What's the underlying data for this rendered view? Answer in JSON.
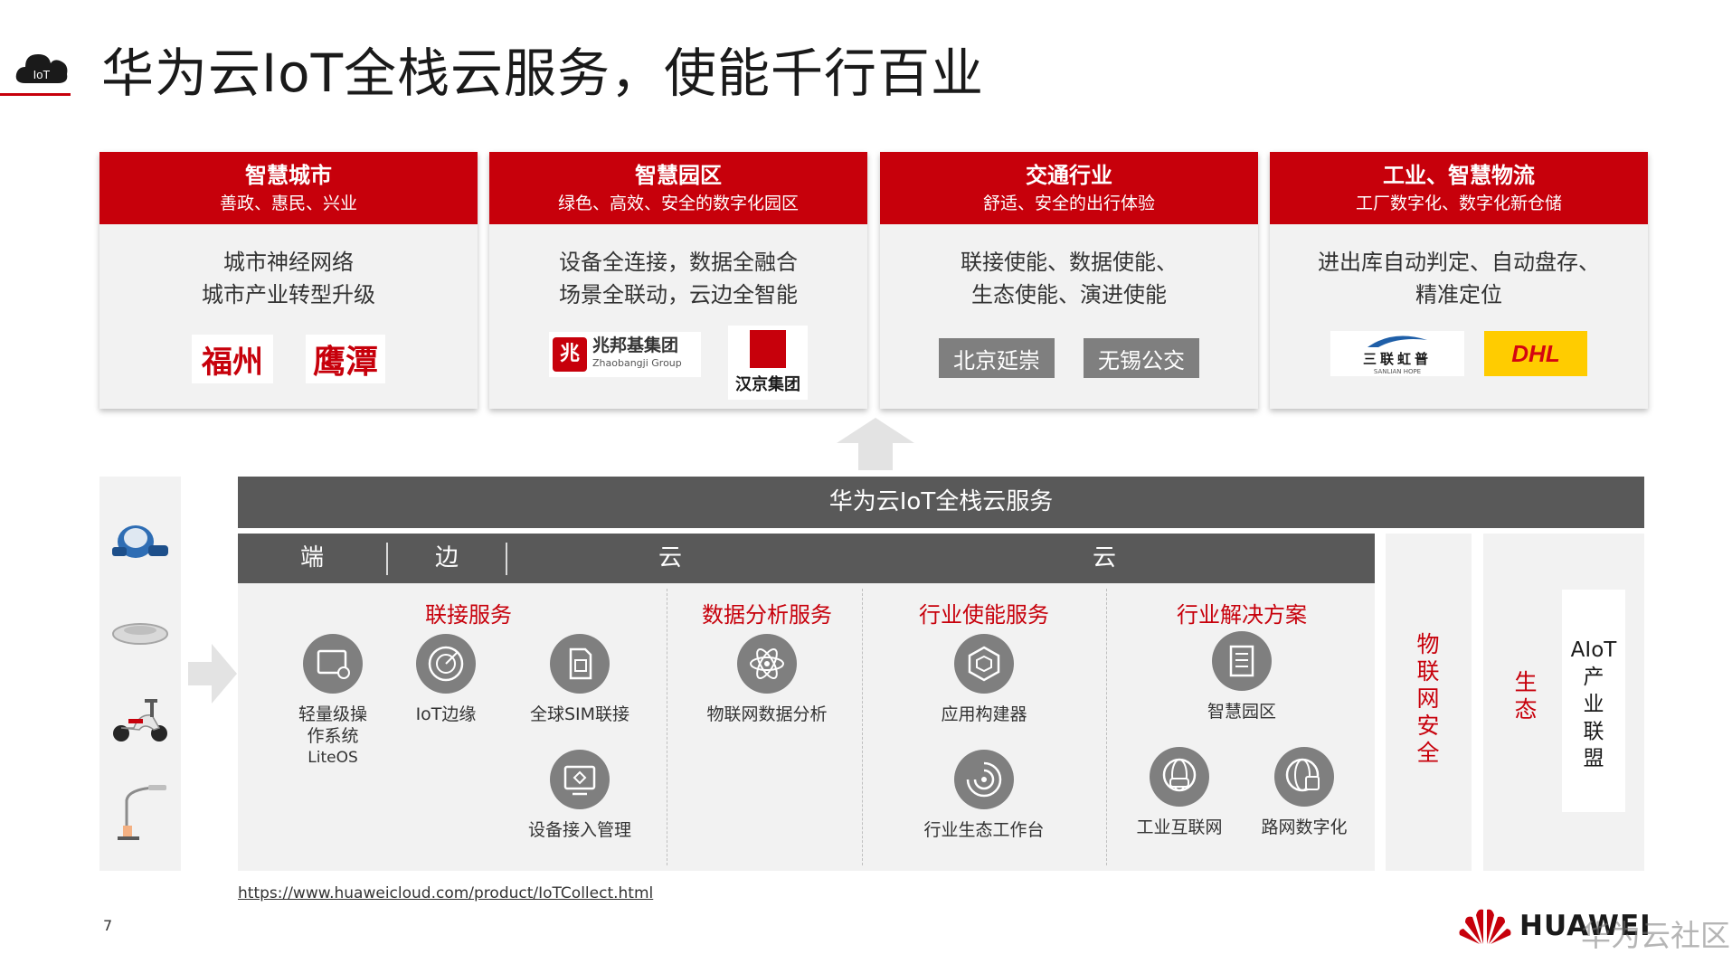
{
  "header": {
    "badge": "IoT",
    "title": "华为云IoT全栈云服务，使能千行百业"
  },
  "cards": [
    {
      "title": "智慧城市",
      "subtitle": "善政、惠民、兴业",
      "desc": [
        "城市神经网络",
        "城市产业转型升级"
      ],
      "logos": [
        "福州",
        "鹰潭"
      ]
    },
    {
      "title": "智慧园区",
      "subtitle": "绿色、高效、安全的数字化园区",
      "desc": [
        "设备全连接，数据全融合",
        "场景全联动，云边全智能"
      ],
      "logos": [
        "兆邦基集团",
        "Zhaobangji Group",
        "汉京集团"
      ]
    },
    {
      "title": "交通行业",
      "subtitle": "舒适、安全的出行体验",
      "desc": [
        "联接使能、数据使能、",
        "生态使能、演进使能"
      ],
      "logos": [
        "北京延崇",
        "无锡公交"
      ]
    },
    {
      "title": "工业、智慧物流",
      "subtitle": "工厂数字化、数字化新仓储",
      "desc": [
        "进出库自动判定、自动盘存、",
        "精准定位"
      ],
      "logos": [
        "三联虹普",
        "SANLIAN HOPE",
        "DHL"
      ]
    }
  ],
  "platform": {
    "title": "华为云IoT全栈云服务",
    "tiers": [
      "端",
      "边",
      "云",
      "云"
    ]
  },
  "services": {
    "connect": {
      "title": "联接服务",
      "items": [
        {
          "label": "轻量级操",
          "label2": "作系统",
          "label3": "LiteOS",
          "icon": "os-icon"
        },
        {
          "label": "IoT边缘",
          "icon": "edge-icon"
        },
        {
          "label": "全球SIM联接",
          "icon": "sim-icon"
        },
        {
          "label": "设备接入管理",
          "icon": "device-access-icon"
        }
      ]
    },
    "analytics": {
      "title": "数据分析服务",
      "items": [
        {
          "label": "物联网数据分析",
          "icon": "atom-icon"
        }
      ]
    },
    "enable": {
      "title": "行业使能服务",
      "items": [
        {
          "label": "应用构建器",
          "icon": "cube-icon"
        },
        {
          "label": "行业生态工作台",
          "icon": "swirl-icon"
        }
      ]
    },
    "solutions": {
      "title": "行业解决方案",
      "items": [
        {
          "label": "智慧园区",
          "icon": "building-icon"
        },
        {
          "label": "工业互联网",
          "icon": "globe-car-icon"
        },
        {
          "label": "路网数字化",
          "icon": "globe-bus-icon"
        }
      ]
    }
  },
  "side": {
    "security": "物联网安全",
    "ecosystem": "生态",
    "aiot": [
      "AIoT",
      "产",
      "业",
      "联",
      "盟"
    ]
  },
  "footer": {
    "url": "https://www.huaweicloud.com/product/IoTCollect.html",
    "page": "7",
    "brand": "HUAWEI",
    "watermark": "华为云社区"
  },
  "colors": {
    "accent": "#c7000b",
    "dark": "#595959",
    "panel": "#f2f2f2"
  }
}
